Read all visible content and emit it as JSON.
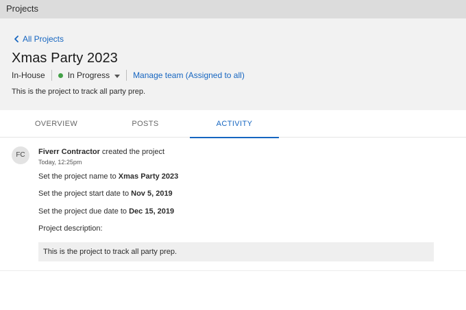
{
  "topbar": {
    "title": "Projects"
  },
  "header": {
    "back_label": "All Projects",
    "title": "Xmas Party 2023",
    "type": "In-House",
    "status": "In Progress",
    "status_color": "#43a047",
    "manage_team": "Manage team (Assigned to all)",
    "description": "This is the project to track all party prep."
  },
  "tabs": [
    {
      "label": "OVERVIEW",
      "active": false
    },
    {
      "label": "POSTS",
      "active": false
    },
    {
      "label": "ACTIVITY",
      "active": true
    }
  ],
  "activity": {
    "avatar_initials": "FC",
    "actor": "Fiverr Contractor",
    "action": " created the project",
    "time": "Today, 12:25pm",
    "lines": [
      {
        "prefix": "Set the project name to ",
        "value": "Xmas Party 2023"
      },
      {
        "prefix": "Set the project start date to ",
        "value": "Nov 5, 2019"
      },
      {
        "prefix": "Set the project due date to ",
        "value": "Dec 15, 2019"
      },
      {
        "prefix": "Project description:",
        "value": ""
      }
    ],
    "description_box": "This is the project to track all party prep."
  },
  "colors": {
    "accent": "#1565c0",
    "header_bg": "#f2f2f2",
    "topbar_bg": "#dcdcdc"
  },
  "icons": {
    "back": "chevron-left-icon",
    "status_menu": "caret-down-icon"
  }
}
